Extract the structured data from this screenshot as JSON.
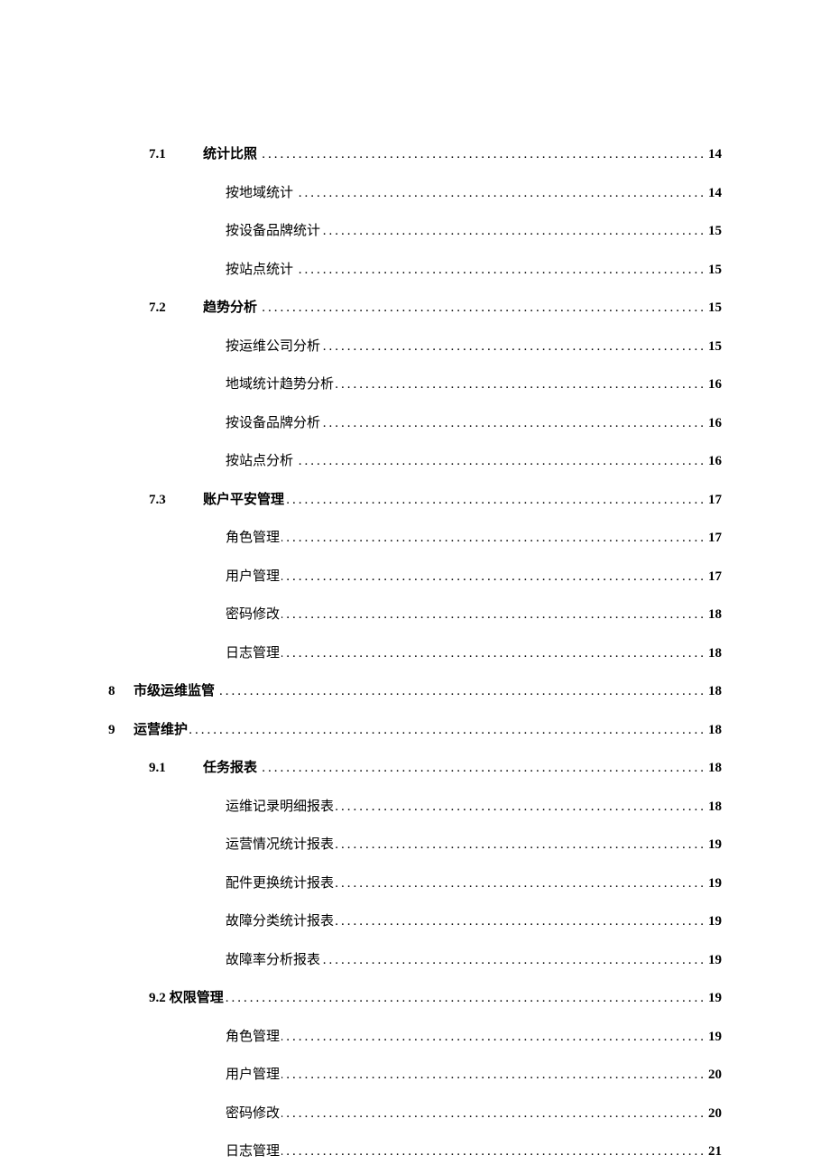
{
  "toc": {
    "s71": {
      "num": "7.1",
      "label": "统计比照",
      "page": "14"
    },
    "s71_1": {
      "label": "按地域统计",
      "page": "14"
    },
    "s71_2": {
      "label": "按设备品牌统计",
      "page": "15"
    },
    "s71_3": {
      "label": "按站点统计",
      "page": "15"
    },
    "s72": {
      "num": "7.2",
      "label": "趋势分析",
      "page": "15"
    },
    "s72_1": {
      "label": "按运维公司分析",
      "page": "15"
    },
    "s72_2": {
      "label": "地域统计趋势分析",
      "page": "16"
    },
    "s72_3": {
      "label": "按设备品牌分析",
      "page": "16"
    },
    "s72_4": {
      "label": "按站点分析",
      "page": "16"
    },
    "s73": {
      "num": "7.3",
      "label": "账户平安管理",
      "page": "17"
    },
    "s73_1": {
      "label": "角色管理",
      "page": "17"
    },
    "s73_2": {
      "label": "用户管理",
      "page": "17"
    },
    "s73_3": {
      "label": "密码修改",
      "page": "18"
    },
    "s73_4": {
      "label": "日志管理",
      "page": "18"
    },
    "s8": {
      "num": "8",
      "label": "市级运维监管",
      "page": "18"
    },
    "s9": {
      "num": "9",
      "label": "运营维护",
      "page": "18"
    },
    "s91": {
      "num": "9.1",
      "label": "任务报表",
      "page": "18"
    },
    "s91_1": {
      "label": "运维记录明细报表",
      "page": "18"
    },
    "s91_2": {
      "label": "运营情况统计报表",
      "page": "19"
    },
    "s91_3": {
      "label": "配件更换统计报表",
      "page": "19"
    },
    "s91_4": {
      "label": "故障分类统计报表",
      "page": "19"
    },
    "s91_5": {
      "label": "故障率分析报表",
      "page": "19"
    },
    "s92": {
      "num": "9.2",
      "label": "权限管理",
      "page": "19"
    },
    "s92_1": {
      "label": "角色管理",
      "page": "19"
    },
    "s92_2": {
      "label": "用户管理",
      "page": "20"
    },
    "s92_3": {
      "label": "密码修改",
      "page": "20"
    },
    "s92_4": {
      "label": "日志管理",
      "page": "21"
    }
  }
}
